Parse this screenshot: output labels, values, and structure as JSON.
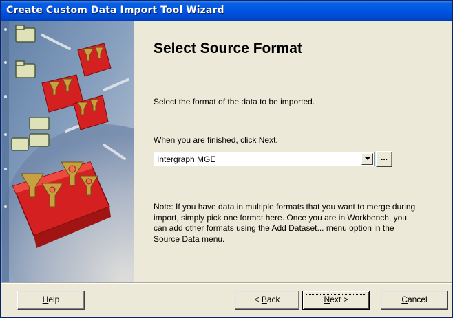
{
  "window": {
    "title": "Create Custom Data Import Tool Wizard"
  },
  "page": {
    "heading": "Select Source Format",
    "instruction": "Select the format of the data to be imported.",
    "finished_hint": "When you are finished, click Next.",
    "format_select": {
      "value": "Intergraph MGE"
    },
    "browse_button_label": "...",
    "note": "Note: If you have data in multiple formats that you want to merge during import, simply pick one format here. Once you are in Workbench, you can add other formats using the Add Dataset... menu option in the Source Data menu."
  },
  "buttons": {
    "help": {
      "mnemonic": "H",
      "rest": "elp"
    },
    "back": {
      "prefix": "< ",
      "mnemonic": "B",
      "rest": "ack"
    },
    "next": {
      "mnemonic": "N",
      "rest": "ext >"
    },
    "cancel": {
      "mnemonic": "C",
      "rest": "ancel"
    }
  },
  "banner": {
    "icons": [
      "folder-icon",
      "toolbox-icon",
      "wrench-icon",
      "funnel-icon"
    ]
  },
  "colors": {
    "titlebar": "#0055e5",
    "dialog_background": "#ece9d8",
    "toolbox_red": "#d42020",
    "funnel_gold": "#c8a040"
  }
}
